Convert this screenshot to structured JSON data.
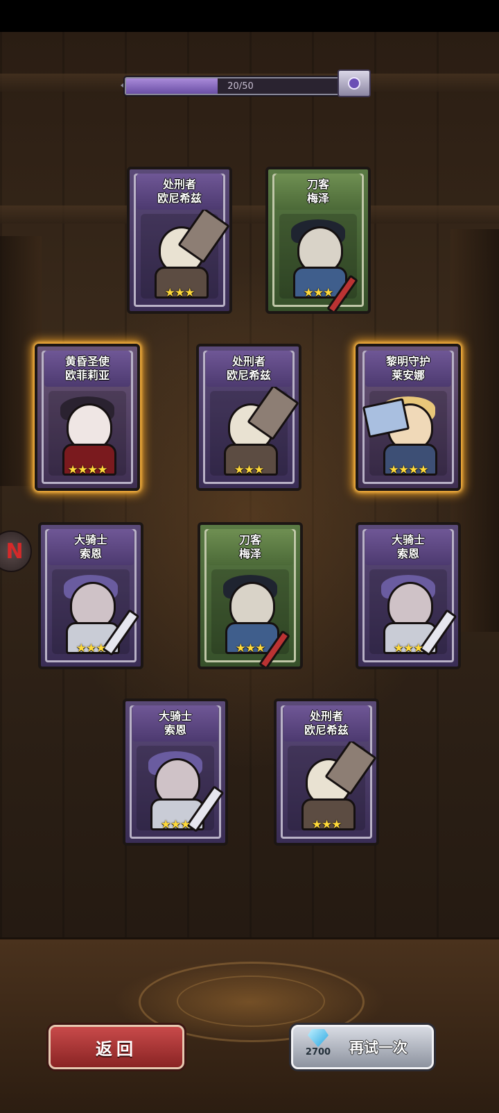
{
  "progress": {
    "label": "20/50",
    "current": 20,
    "max": 50
  },
  "side_badge": {
    "icon": "banner-icon",
    "glyph": "N"
  },
  "cards": [
    {
      "title_line1": "处刑者",
      "title_line2": "欧尼希兹",
      "stars": "★★★",
      "star_count": 3,
      "frame": "purple",
      "glow": false,
      "art": "bandage"
    },
    {
      "title_line1": "刀客",
      "title_line2": "梅泽",
      "stars": "★★★",
      "star_count": 3,
      "frame": "green",
      "glow": false,
      "art": "ninja"
    },
    {
      "title_line1": "黄昏圣使",
      "title_line2": "欧菲莉亚",
      "stars": "★★★★",
      "star_count": 4,
      "frame": "gold",
      "glow": true,
      "art": "saint"
    },
    {
      "title_line1": "处刑者",
      "title_line2": "欧尼希兹",
      "stars": "★★★",
      "star_count": 3,
      "frame": "purple",
      "glow": false,
      "art": "bandage"
    },
    {
      "title_line1": "黎明守护",
      "title_line2": "莱安娜",
      "stars": "★★★★",
      "star_count": 4,
      "frame": "gold",
      "glow": true,
      "art": "dawn"
    },
    {
      "title_line1": "大骑士",
      "title_line2": "索恩",
      "stars": "★★★",
      "star_count": 3,
      "frame": "purple",
      "glow": false,
      "art": "knight"
    },
    {
      "title_line1": "刀客",
      "title_line2": "梅泽",
      "stars": "★★★",
      "star_count": 3,
      "frame": "green",
      "glow": false,
      "art": "ninja"
    },
    {
      "title_line1": "大骑士",
      "title_line2": "索恩",
      "stars": "★★★",
      "star_count": 3,
      "frame": "purple",
      "glow": false,
      "art": "knight"
    },
    {
      "title_line1": "大骑士",
      "title_line2": "索恩",
      "stars": "★★★",
      "star_count": 3,
      "frame": "purple",
      "glow": false,
      "art": "knight"
    },
    {
      "title_line1": "处刑者",
      "title_line2": "欧尼希兹",
      "stars": "★★★",
      "star_count": 3,
      "frame": "purple",
      "glow": false,
      "art": "bandage"
    }
  ],
  "buttons": {
    "back_label": "返回",
    "retry_label": "再试一次",
    "retry_cost": "2700",
    "currency_icon": "diamond-icon"
  },
  "colors": {
    "glow": "#ffaa28",
    "progress_fill": "#8f6fd0",
    "back_button": "#b23a3a",
    "retry_button": "#c4c8d2"
  }
}
